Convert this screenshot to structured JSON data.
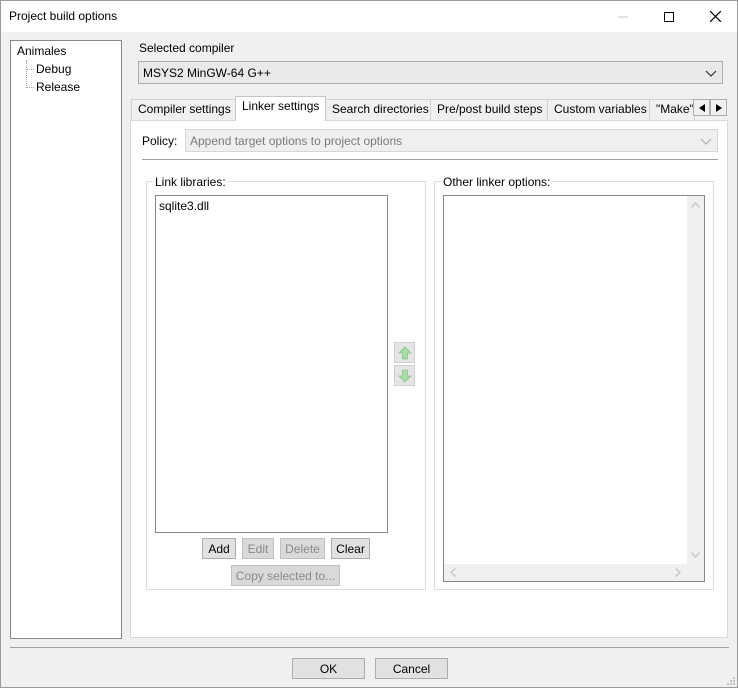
{
  "window": {
    "title": "Project build options",
    "controls": {
      "minimize": "minimize-icon",
      "maximize": "maximize-icon",
      "close": "close-icon"
    }
  },
  "tree": {
    "root": "Animales",
    "children": [
      "Debug",
      "Release"
    ]
  },
  "compiler": {
    "label": "Selected compiler",
    "value": "MSYS2 MinGW-64 G++"
  },
  "tabs": [
    {
      "label": "Compiler settings",
      "active": false
    },
    {
      "label": "Linker settings",
      "active": true
    },
    {
      "label": "Search directories",
      "active": false
    },
    {
      "label": "Pre/post build steps",
      "active": false
    },
    {
      "label": "Custom variables",
      "active": false
    },
    {
      "label": "\"Make\"",
      "active": false
    }
  ],
  "linker": {
    "policy_label": "Policy:",
    "policy_value": "Append target options to project options",
    "link_libraries": {
      "title": "Link libraries:",
      "items": [
        "sqlite3.dll"
      ],
      "buttons": {
        "add": "Add",
        "edit": "Edit",
        "delete": "Delete",
        "clear": "Clear",
        "copy": "Copy selected to..."
      }
    },
    "other_options": {
      "title": "Other linker options:",
      "value": ""
    }
  },
  "footer": {
    "ok": "OK",
    "cancel": "Cancel"
  },
  "colors": {
    "accent_arrow": "#7fc97f",
    "border": "#adadad"
  }
}
